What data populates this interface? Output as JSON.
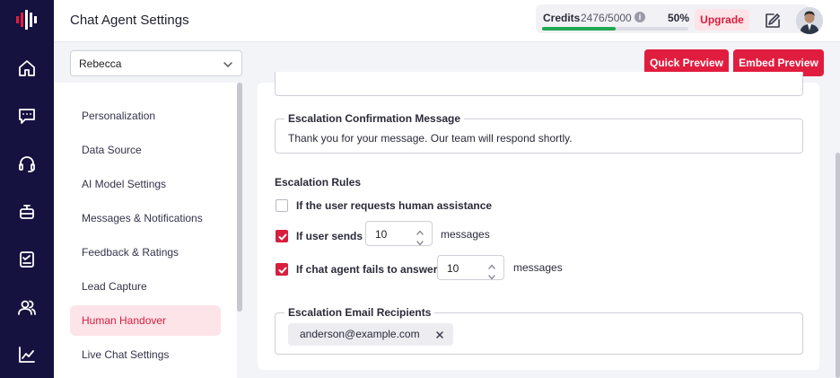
{
  "header": {
    "title": "Chat Agent Settings",
    "credits_label": "Credits",
    "credits_value": "2476/5000",
    "credits_percent": "50%",
    "credits_fraction": 0.5,
    "upgrade_label": "Upgrade"
  },
  "rail": {
    "icons": [
      "logo-icon",
      "home-icon",
      "chat-icon",
      "headset-icon",
      "bot-icon",
      "checklist-icon",
      "users-icon",
      "analytics-icon"
    ]
  },
  "toolbar": {
    "agent_value": "Rebecca",
    "quick_preview_label": "Quick Preview",
    "embed_preview_label": "Embed Preview"
  },
  "sidebar": {
    "items": [
      {
        "label": "Personalization",
        "active": false
      },
      {
        "label": "Data Source",
        "active": false
      },
      {
        "label": "AI Model Settings",
        "active": false
      },
      {
        "label": "Messages & Notifications",
        "active": false
      },
      {
        "label": "Feedback & Ratings",
        "active": false
      },
      {
        "label": "Lead Capture",
        "active": false
      },
      {
        "label": "Human Handover",
        "active": true
      },
      {
        "label": "Live Chat Settings",
        "active": false
      }
    ]
  },
  "main": {
    "confirmation": {
      "label": "Escalation Confirmation Message",
      "value": "Thank you for your message. Our team will respond shortly."
    },
    "rules": {
      "title": "Escalation Rules",
      "items": [
        {
          "label": "If the user requests human assistance",
          "checked": false
        },
        {
          "label": "If user sends",
          "checked": true,
          "count": "10",
          "suffix": "messages"
        },
        {
          "label": "If chat agent fails to answer",
          "checked": true,
          "count": "10",
          "suffix": "messages"
        }
      ]
    },
    "recipients": {
      "label": "Escalation Email Recipients",
      "chips": [
        "anderson@example.com"
      ]
    }
  },
  "colors": {
    "accent": "#e11d3f",
    "rail": "#16123f",
    "progress": "#20a852"
  }
}
